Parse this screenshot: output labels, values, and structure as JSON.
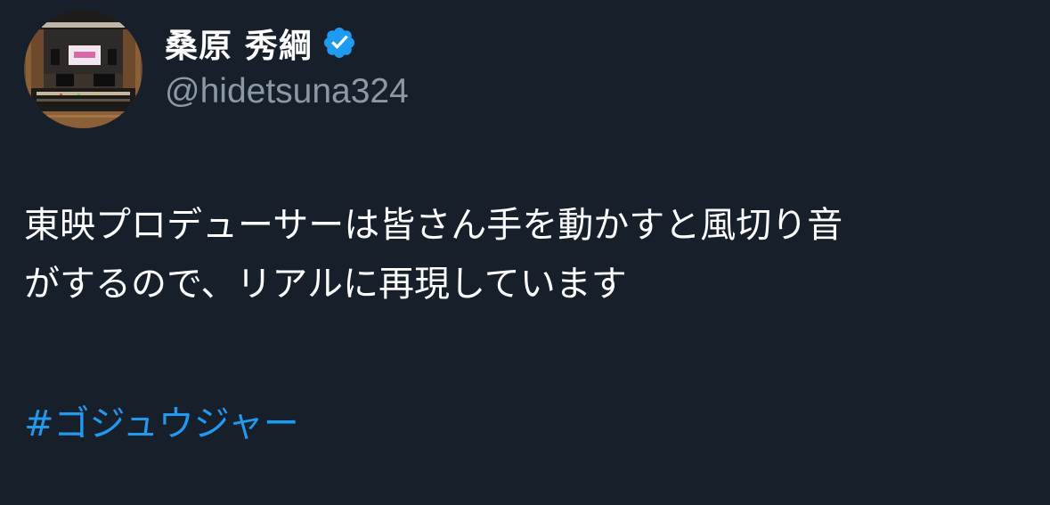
{
  "author": {
    "display_name": "桑原 秀綱",
    "handle": "@hidetsuna324",
    "verified": true,
    "verified_badge_icon": "verified-badge-icon",
    "avatar_icon": "studio-avatar-image"
  },
  "tweet": {
    "text_lines": [
      "東映プロデューサーは皆さん手を動かすと風切り音",
      "がするので、リアルに再現しています"
    ],
    "hashtag": "#ゴジュウジャー"
  },
  "colors": {
    "background": "#161f2a",
    "text": "#ffffff",
    "secondary_text": "#8b98a5",
    "link": "#1d9bf0",
    "verified_badge": "#1d9bf0"
  }
}
